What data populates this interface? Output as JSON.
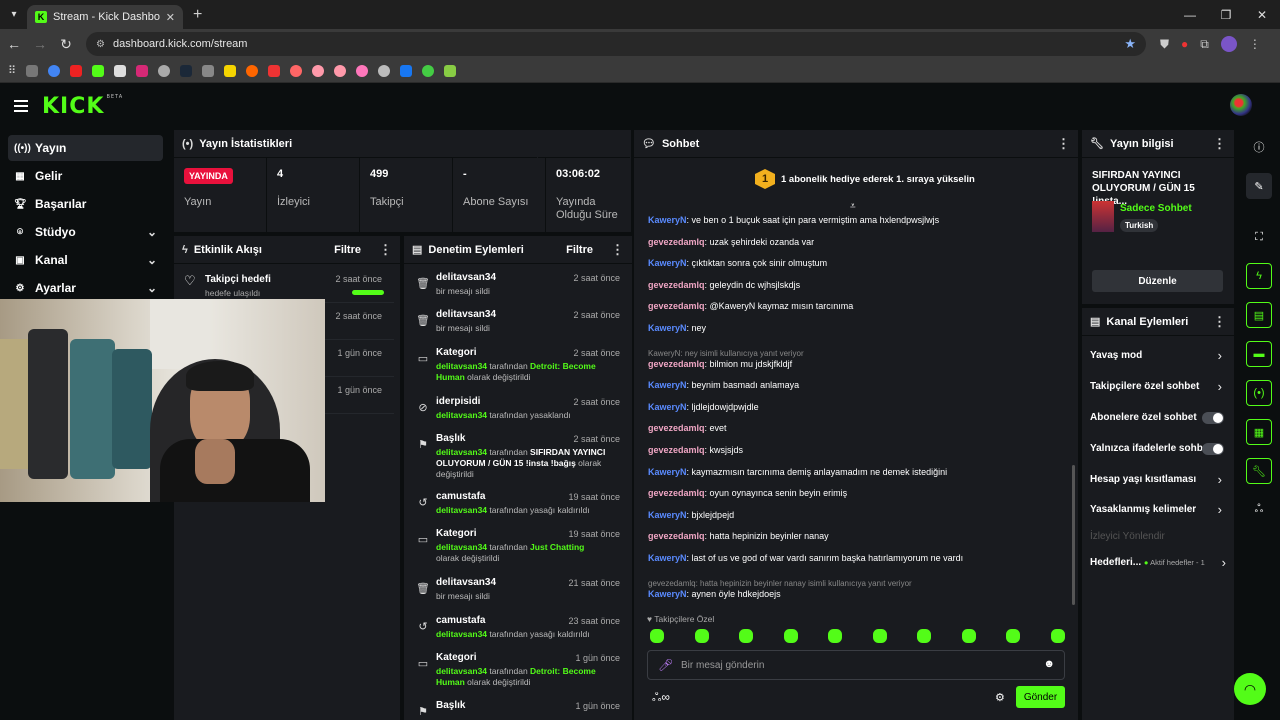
{
  "browser": {
    "tab_title": "Stream - Kick Dashboard",
    "url": "dashboard.kick.com/stream"
  },
  "header": {
    "logo": "KICK",
    "logo_sup": "BETA"
  },
  "nav": {
    "items": [
      {
        "label": "Yayın",
        "icon": "broadcast-icon",
        "active": true
      },
      {
        "label": "Gelir",
        "icon": "revenue-icon"
      },
      {
        "label": "Başarılar",
        "icon": "trophy-icon"
      },
      {
        "label": "Stüdyo",
        "icon": "studio-icon"
      },
      {
        "label": "Kanal",
        "icon": "channel-icon"
      },
      {
        "label": "Ayarlar",
        "icon": "gear-icon"
      }
    ]
  },
  "stats": {
    "title": "Yayın İstatistikleri",
    "live_badge": "YAYINDA",
    "items": [
      {
        "value": "",
        "label": "Yayın"
      },
      {
        "value": "4",
        "label": "İzleyici"
      },
      {
        "value": "499",
        "label": "Takipçi"
      },
      {
        "value": "-",
        "label": "Abone Sayısı"
      },
      {
        "value": "03:06:02",
        "label": "Yayında Olduğu Süre"
      }
    ]
  },
  "activity": {
    "title": "Etkinlik Akışı",
    "filter": "Filtre",
    "items": [
      {
        "title": "Takipçi hedefi",
        "sub": "hedefe ulaşıldı",
        "time": "2 saat önce"
      },
      {
        "time": "2 saat önce"
      },
      {
        "time": "1 gün önce"
      },
      {
        "time": "1 gün önce"
      }
    ]
  },
  "moderation": {
    "title": "Denetim Eylemleri",
    "filter": "Filtre",
    "items": [
      {
        "icon": "trash-icon",
        "title": "delitavsan34",
        "time": "2 saat önce",
        "desc": "bir mesajı sildi"
      },
      {
        "icon": "trash-icon",
        "title": "delitavsan34",
        "time": "2 saat önce",
        "desc": "bir mesajı sildi"
      },
      {
        "icon": "category-icon",
        "title": "Kategori",
        "time": "2 saat önce",
        "user": "delitavsan34",
        "mid": " tarafından ",
        "val": "Detroit: Become Human",
        "end": " olarak değiştirildi"
      },
      {
        "icon": "ban-icon",
        "title": "iderpisidi",
        "time": "2 saat önce",
        "user": "delitavsan34",
        "mid": " tarafından yasaklandı"
      },
      {
        "icon": "title-icon",
        "title": "Başlık",
        "time": "2 saat önce",
        "user": "delitavsan34",
        "mid": " tarafından ",
        "val": "SIFIRDAN YAYINCI OLUYORUM / GÜN 15 !insta !bağış",
        "end": " olarak değiştirildi"
      },
      {
        "icon": "undo-icon",
        "title": "camustafa",
        "time": "19 saat önce",
        "user": "delitavsan34",
        "mid": " tarafından yasağı kaldırıldı"
      },
      {
        "icon": "category-icon",
        "title": "Kategori",
        "time": "19 saat önce",
        "user": "delitavsan34",
        "mid": " tarafından ",
        "val": "Just Chatting",
        "end": " olarak değiştirildi"
      },
      {
        "icon": "trash-icon",
        "title": "delitavsan34",
        "time": "21 saat önce",
        "desc": "bir mesajı sildi"
      },
      {
        "icon": "undo-icon",
        "title": "camustafa",
        "time": "23 saat önce",
        "user": "delitavsan34",
        "mid": " tarafından yasağı kaldırıldı"
      },
      {
        "icon": "category-icon",
        "title": "Kategori",
        "time": "1 gün önce",
        "user": "delitavsan34",
        "mid": " tarafından ",
        "val": "Detroit: Become Human",
        "end": " olarak değiştirildi"
      },
      {
        "icon": "title-icon",
        "title": "Başlık",
        "time": "1 gün önce"
      }
    ]
  },
  "chat": {
    "title": "Sohbet",
    "pinned": "1 abonelik hediye ederek 1. sıraya yükselin",
    "pinned_rank": "1",
    "messages": [
      {
        "user": "KaweryN",
        "color": "blue",
        "text": "ve ben o 1 buçuk saat için para vermiştim ama hxlendpwsjlwjs"
      },
      {
        "user": "gevezedamlq",
        "color": "pink",
        "text": "uzak şehirdeki ozanda var"
      },
      {
        "user": "KaweryN",
        "color": "blue",
        "text": "çıktıktan sonra çok sinir olmuştum"
      },
      {
        "user": "gevezedamlq",
        "color": "pink",
        "text": "geleydin dc wjhsjlskdjs"
      },
      {
        "user": "gevezedamlq",
        "color": "pink",
        "text": "@KaweryN kaymaz mısın tarcınıma"
      },
      {
        "user": "KaweryN",
        "color": "blue",
        "text": "ney"
      },
      {
        "reply": "KaweryN: ney isimli kullanıcıya yanıt veriyor",
        "user": "gevezedamlq",
        "color": "pink",
        "text": "bilmion mu jdskjfkldjf"
      },
      {
        "user": "KaweryN",
        "color": "blue",
        "text": "beynim basmadı anlamaya"
      },
      {
        "user": "KaweryN",
        "color": "blue",
        "text": "ljdlejdowjdpwjdle"
      },
      {
        "user": "gevezedamlq",
        "color": "pink",
        "text": "evet"
      },
      {
        "user": "gevezedamlq",
        "color": "pink",
        "text": "kwsjsjds"
      },
      {
        "user": "KaweryN",
        "color": "blue",
        "text": "kaymazmısın tarcınıma demiş anlayamadım ne demek istediğini"
      },
      {
        "user": "gevezedamlq",
        "color": "pink",
        "text": "oyun oynayınca senin beyin erimiş"
      },
      {
        "user": "KaweryN",
        "color": "blue",
        "text": "bjxlejdpejd"
      },
      {
        "user": "gevezedamlq",
        "color": "pink",
        "text": "hatta hepinizin beyinler nanay"
      },
      {
        "user": "KaweryN",
        "color": "blue",
        "text": "last of us ve god of war vardı sanırım başka hatırlamıyorum ne vardı"
      },
      {
        "reply": "gevezedamlq: hatta hepinizin beyinler nanay isimli kullanıcıya yanıt veriyor",
        "user": "KaweryN",
        "color": "blue",
        "text": "aynen öyle hdkejdoejs"
      }
    ],
    "emote_label": "Takipçilere Özel",
    "input_placeholder": "Bir mesaj gönderin",
    "send": "Gönder"
  },
  "stream_info": {
    "title": "Yayın bilgisi",
    "stream_title": "SIFIRDAN YAYINCI OLUYORUM / GÜN 15 !insta...",
    "category": "Sadece Sohbet",
    "tag": "Turkish",
    "edit": "Düzenle"
  },
  "channel_actions": {
    "title": "Kanal Eylemleri",
    "items": [
      {
        "label": "Yavaş mod",
        "type": "arrow"
      },
      {
        "label": "Takipçilere özel sohbet",
        "type": "arrow"
      },
      {
        "label": "Abonelere özel sohbet",
        "type": "toggle"
      },
      {
        "label": "Yalnızca ifadelerle sohbet",
        "type": "toggle"
      },
      {
        "label": "Hesap yaşı kısıtlaması",
        "type": "arrow"
      },
      {
        "label": "Yasaklanmış kelimeler",
        "type": "arrow"
      },
      {
        "label": "İzleyici Yönlendir",
        "type": "disabled"
      },
      {
        "label": "Hedefleri...",
        "type": "goals",
        "extra": "Aktif hedefler - 1"
      }
    ]
  },
  "colors": {
    "brand": "#53fc18",
    "live": "#e9113c"
  }
}
